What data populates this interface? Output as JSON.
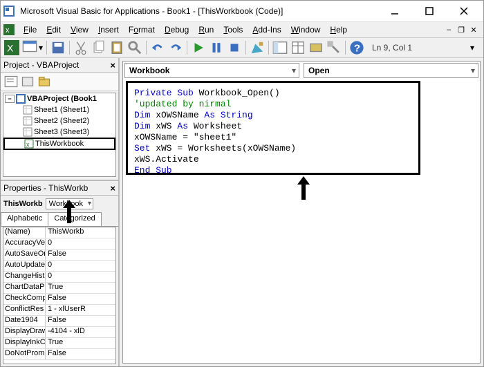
{
  "title": "Microsoft Visual Basic for Applications - Book1 - [ThisWorkbook (Code)]",
  "menu": {
    "file": "File",
    "edit": "Edit",
    "view": "View",
    "insert": "Insert",
    "format": "Format",
    "debug": "Debug",
    "run": "Run",
    "tools": "Tools",
    "addins": "Add-Ins",
    "window": "Window",
    "help": "Help"
  },
  "toolbar_status": "Ln 9, Col 1",
  "project_panel_title": "Project - VBAProject",
  "project_root": "VBAProject (Book1",
  "project_sheets": [
    "Sheet1 (Sheet1)",
    "Sheet2 (Sheet2)",
    "Sheet3 (Sheet3)"
  ],
  "project_thisworkbook": "ThisWorkbook",
  "properties_title": "Properties - ThisWorkb",
  "properties_obj_name": "ThisWorkb",
  "properties_obj_type": "Workbook",
  "properties_tabs": {
    "alpha": "Alphabetic",
    "cat": "Categorized"
  },
  "properties_rows": [
    {
      "n": "(Name)",
      "v": "ThisWorkb"
    },
    {
      "n": "AccuracyVe",
      "v": "0"
    },
    {
      "n": "AutoSaveOn",
      "v": "False"
    },
    {
      "n": "AutoUpdate",
      "v": "0"
    },
    {
      "n": "ChangeHist",
      "v": "0"
    },
    {
      "n": "ChartDataP",
      "v": "True"
    },
    {
      "n": "CheckComp",
      "v": "False"
    },
    {
      "n": "ConflictRes",
      "v": "1 - xlUserR"
    },
    {
      "n": "Date1904",
      "v": "False"
    },
    {
      "n": "DisplayDraw",
      "v": "-4104 - xlD"
    },
    {
      "n": "DisplayInkC",
      "v": "True"
    },
    {
      "n": "DoNotPrompt",
      "v": "False"
    }
  ],
  "code_dd_left": "Workbook",
  "code_dd_right": "Open",
  "code": {
    "l1a": "Private Sub",
    "l1b": " Workbook_Open()",
    "l2": "'updated by nirmal",
    "l3a": "Dim",
    "l3b": " xOWSName ",
    "l3c": "As String",
    "l4a": "Dim",
    "l4b": " xWS ",
    "l4c": "As",
    "l4d": " Worksheet",
    "l5": "    xOWSName = \"sheet1\"",
    "l6a": "    Set",
    "l6b": " xWS = Worksheets(xOWSName)",
    "l7": "    xWS.Activate",
    "l8": "End Sub"
  }
}
